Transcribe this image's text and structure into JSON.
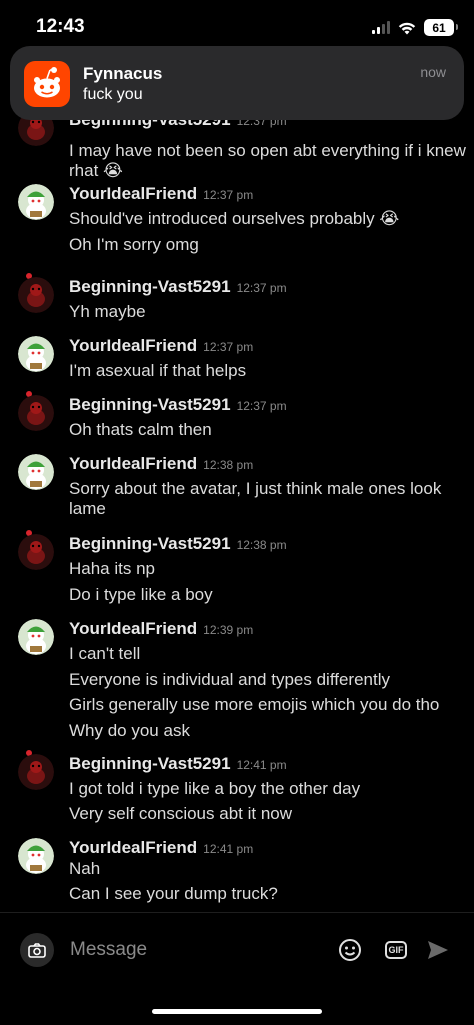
{
  "status_bar": {
    "time": "12:43",
    "battery": "61"
  },
  "notification": {
    "app_icon": "reddit-icon",
    "title": "Fynnacus",
    "body": "fuck you",
    "time": "now"
  },
  "users": {
    "a": "Beginning-Vast5291",
    "b": "YourIdealFriend"
  },
  "messages": [
    {
      "user": "Beginning-Vast5291",
      "time": "12:37 pm",
      "lines": [
        "I may have not been so open abt everything if i knew rhat 😭"
      ]
    },
    {
      "user": "YourIdealFriend",
      "time": "12:37 pm",
      "lines": [
        "Should've introduced ourselves probably 😭",
        "Oh I'm sorry omg"
      ]
    },
    {
      "user": "Beginning-Vast5291",
      "time": "12:37 pm",
      "lines": [
        "Yh maybe"
      ]
    },
    {
      "user": "YourIdealFriend",
      "time": "12:37 pm",
      "lines": [
        "I'm asexual if that helps"
      ]
    },
    {
      "user": "Beginning-Vast5291",
      "time": "12:37 pm",
      "lines": [
        "Oh thats calm then"
      ]
    },
    {
      "user": "YourIdealFriend",
      "time": "12:38 pm",
      "lines": [
        "Sorry about the avatar, I just think male ones look lame"
      ]
    },
    {
      "user": "Beginning-Vast5291",
      "time": "12:38 pm",
      "lines": [
        "Haha its np",
        "Do i type like a boy"
      ]
    },
    {
      "user": "YourIdealFriend",
      "time": "12:39 pm",
      "lines": [
        "I can't tell",
        "Everyone is individual and types differently",
        "Girls generally use more emojis which you do tho",
        "Why do you ask"
      ]
    },
    {
      "user": "Beginning-Vast5291",
      "time": "12:41 pm",
      "lines": [
        "I got told i type like a boy the other day",
        "Very self conscious abt it now"
      ]
    },
    {
      "user": "YourIdealFriend",
      "time": "12:41 pm",
      "lines": [
        "Nah",
        "Can I see your dump truck?"
      ]
    }
  ],
  "composer": {
    "placeholder": "Message",
    "camera_icon": "camera-icon",
    "emoji_icon": "emoji-icon",
    "gif_label": "GIF",
    "send_icon": "send-icon"
  },
  "colors": {
    "background": "#000000",
    "reddit_orange": "#ff4500",
    "notification_bg": "#2a2a2c",
    "timestamp": "#8a8a8a"
  }
}
